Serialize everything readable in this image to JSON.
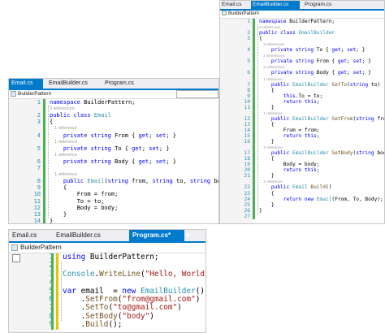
{
  "win_email": {
    "tabs": [
      "Email.cs",
      "EmailBuilder.cs",
      "Program.cs"
    ],
    "nav": "BuilderPattern",
    "lines": [
      {
        "n": "1",
        "t": [
          [
            "kw",
            "namespace "
          ],
          [
            "pl",
            "BuilderPattern;"
          ]
        ]
      },
      {
        "n": "",
        "t": [
          [
            "ref",
            "3 references"
          ]
        ]
      },
      {
        "n": "2",
        "t": [
          [
            "kw",
            "public class "
          ],
          [
            "ty",
            "Email"
          ]
        ]
      },
      {
        "n": "3",
        "t": [
          [
            "pl",
            "{"
          ]
        ]
      },
      {
        "n": "",
        "t": [
          [
            "ref",
            "    1 reference"
          ]
        ]
      },
      {
        "n": "4",
        "t": [
          [
            "kw",
            "    private string "
          ],
          [
            "pl",
            "From { "
          ],
          [
            "kw",
            "get"
          ],
          [
            "pl",
            "; "
          ],
          [
            "kw",
            "set"
          ],
          [
            "pl",
            "; }"
          ]
        ]
      },
      {
        "n": "",
        "t": [
          [
            "ref",
            "    1 reference"
          ]
        ]
      },
      {
        "n": "5",
        "t": [
          [
            "kw",
            "    private string "
          ],
          [
            "pl",
            "To { "
          ],
          [
            "kw",
            "get"
          ],
          [
            "pl",
            "; "
          ],
          [
            "kw",
            "set"
          ],
          [
            "pl",
            "; }"
          ]
        ]
      },
      {
        "n": "",
        "t": [
          [
            "ref",
            "    1 reference"
          ]
        ]
      },
      {
        "n": "6",
        "t": [
          [
            "kw",
            "    private string "
          ],
          [
            "pl",
            "Body { "
          ],
          [
            "kw",
            "get"
          ],
          [
            "pl",
            "; "
          ],
          [
            "kw",
            "set"
          ],
          [
            "pl",
            "; }"
          ]
        ]
      },
      {
        "n": "7",
        "t": [
          [
            "pl",
            ""
          ]
        ]
      },
      {
        "n": "",
        "t": [
          [
            "ref",
            "    1 reference"
          ]
        ]
      },
      {
        "n": "8",
        "t": [
          [
            "kw",
            "    public "
          ],
          [
            "ty",
            "Email"
          ],
          [
            "pl",
            "("
          ],
          [
            "kw",
            "string "
          ],
          [
            "pl",
            "from, "
          ],
          [
            "kw",
            "string "
          ],
          [
            "pl",
            "to, "
          ],
          [
            "kw",
            "string "
          ],
          [
            "pl",
            "body)"
          ]
        ]
      },
      {
        "n": "9",
        "t": [
          [
            "pl",
            "    {"
          ]
        ]
      },
      {
        "n": "10",
        "t": [
          [
            "pl",
            "        From = from;"
          ]
        ]
      },
      {
        "n": "11",
        "t": [
          [
            "pl",
            "        To = to;"
          ]
        ]
      },
      {
        "n": "12",
        "t": [
          [
            "pl",
            "        Body = body;"
          ]
        ]
      },
      {
        "n": "13",
        "t": [
          [
            "pl",
            "    }"
          ]
        ]
      },
      {
        "n": "14",
        "t": [
          [
            "pl",
            "}"
          ]
        ]
      }
    ]
  },
  "win_builder": {
    "tabs": [
      "Email.cs",
      "EmailBuilder.cs",
      "Program.cs"
    ],
    "nav": "BuilderPattern",
    "lines": [
      {
        "n": "1",
        "t": [
          [
            "kw",
            "namespace "
          ],
          [
            "pl",
            "BuilderPattern;"
          ]
        ]
      },
      {
        "n": "",
        "t": [
          [
            "ref",
            "4 references"
          ]
        ]
      },
      {
        "n": "2",
        "t": [
          [
            "kw",
            "public class "
          ],
          [
            "ty",
            "EmailBuilder"
          ]
        ]
      },
      {
        "n": "3",
        "t": [
          [
            "pl",
            "{"
          ]
        ]
      },
      {
        "n": "",
        "t": [
          [
            "ref",
            "    2 references"
          ]
        ]
      },
      {
        "n": "4",
        "t": [
          [
            "kw",
            "    private string "
          ],
          [
            "pl",
            "To { "
          ],
          [
            "kw",
            "get"
          ],
          [
            "pl",
            "; "
          ],
          [
            "kw",
            "set"
          ],
          [
            "pl",
            "; }"
          ]
        ]
      },
      {
        "n": "",
        "t": [
          [
            "ref",
            "    2 references"
          ]
        ]
      },
      {
        "n": "5",
        "t": [
          [
            "kw",
            "    private string "
          ],
          [
            "pl",
            "From { "
          ],
          [
            "kw",
            "get"
          ],
          [
            "pl",
            "; "
          ],
          [
            "kw",
            "set"
          ],
          [
            "pl",
            "; }"
          ]
        ]
      },
      {
        "n": "",
        "t": [
          [
            "ref",
            "    2 references"
          ]
        ]
      },
      {
        "n": "6",
        "t": [
          [
            "kw",
            "    private string "
          ],
          [
            "pl",
            "Body { "
          ],
          [
            "kw",
            "get"
          ],
          [
            "pl",
            "; "
          ],
          [
            "kw",
            "set"
          ],
          [
            "pl",
            "; }"
          ]
        ]
      },
      {
        "n": "",
        "t": [
          [
            "ref",
            "    1 reference"
          ]
        ]
      },
      {
        "n": "7",
        "t": [
          [
            "kw",
            "    public "
          ],
          [
            "ty",
            "EmailBuilder "
          ],
          [
            "mb",
            "SetTo"
          ],
          [
            "pl",
            "("
          ],
          [
            "kw",
            "string "
          ],
          [
            "pl",
            "to)"
          ]
        ]
      },
      {
        "n": "8",
        "t": [
          [
            "pl",
            "    {"
          ]
        ]
      },
      {
        "n": "9",
        "t": [
          [
            "kw",
            "        this"
          ],
          [
            "pl",
            ".To = to;"
          ]
        ]
      },
      {
        "n": "10",
        "t": [
          [
            "kw",
            "        return this"
          ],
          [
            "pl",
            ";"
          ]
        ]
      },
      {
        "n": "11",
        "t": [
          [
            "pl",
            "    }"
          ]
        ]
      },
      {
        "n": "",
        "t": [
          [
            "ref",
            "    1 reference"
          ]
        ]
      },
      {
        "n": "12",
        "t": [
          [
            "kw",
            "    public "
          ],
          [
            "ty",
            "EmailBuilder "
          ],
          [
            "mb",
            "SetFrom"
          ],
          [
            "pl",
            "("
          ],
          [
            "kw",
            "string "
          ],
          [
            "pl",
            "from)"
          ]
        ]
      },
      {
        "n": "13",
        "t": [
          [
            "pl",
            "    {"
          ]
        ]
      },
      {
        "n": "14",
        "t": [
          [
            "pl",
            "        From = from;"
          ]
        ]
      },
      {
        "n": "15",
        "t": [
          [
            "kw",
            "        return this"
          ],
          [
            "pl",
            ";"
          ]
        ]
      },
      {
        "n": "16",
        "t": [
          [
            "pl",
            "    }"
          ]
        ]
      },
      {
        "n": "",
        "t": [
          [
            "ref",
            "    1 reference"
          ]
        ]
      },
      {
        "n": "17",
        "t": [
          [
            "kw",
            "    public "
          ],
          [
            "ty",
            "EmailBuilder "
          ],
          [
            "mb",
            "SetBody"
          ],
          [
            "pl",
            "("
          ],
          [
            "kw",
            "string "
          ],
          [
            "pl",
            "body)"
          ]
        ]
      },
      {
        "n": "18",
        "t": [
          [
            "pl",
            "    {"
          ]
        ]
      },
      {
        "n": "19",
        "t": [
          [
            "pl",
            "        Body = body;"
          ]
        ]
      },
      {
        "n": "20",
        "t": [
          [
            "kw",
            "        return this"
          ],
          [
            "pl",
            ";"
          ]
        ]
      },
      {
        "n": "21",
        "t": [
          [
            "pl",
            "    }"
          ]
        ]
      },
      {
        "n": "",
        "t": [
          [
            "ref",
            "    1 reference"
          ]
        ]
      },
      {
        "n": "22",
        "t": [
          [
            "kw",
            "    public "
          ],
          [
            "ty",
            "Email "
          ],
          [
            "mb",
            "Build"
          ],
          [
            "pl",
            "()"
          ]
        ]
      },
      {
        "n": "23",
        "t": [
          [
            "pl",
            "    {"
          ]
        ]
      },
      {
        "n": "24",
        "t": [
          [
            "kw",
            "        return new "
          ],
          [
            "ty",
            "Email"
          ],
          [
            "pl",
            "(From, To, Body);"
          ]
        ]
      },
      {
        "n": "25",
        "t": [
          [
            "pl",
            "    }"
          ]
        ]
      },
      {
        "n": "26",
        "t": [
          [
            "pl",
            "}"
          ]
        ]
      },
      {
        "n": "27",
        "t": [
          [
            "pl",
            ""
          ]
        ]
      }
    ]
  },
  "win_program": {
    "tabs": [
      "Email.cs",
      "EmailBuilder.cs",
      "Program.cs*"
    ],
    "nav": "BuilderPattern",
    "lines": [
      {
        "n": "1",
        "t": [
          [
            "kw",
            "using "
          ],
          [
            "pl",
            "BuilderPattern;"
          ]
        ]
      },
      {
        "n": "2",
        "t": [
          [
            "pl",
            ""
          ]
        ]
      },
      {
        "n": "3",
        "t": [
          [
            "ty",
            "Console"
          ],
          [
            "pl",
            "."
          ],
          [
            "mb",
            "WriteLine"
          ],
          [
            "pl",
            "("
          ],
          [
            "str",
            "\"Hello, World!\""
          ],
          [
            "pl",
            ");"
          ]
        ]
      },
      {
        "n": "4",
        "t": [
          [
            "pl",
            ""
          ]
        ]
      },
      {
        "n": "5",
        "t": [
          [
            "kw",
            "var "
          ],
          [
            "pl",
            "email  = "
          ],
          [
            "kw",
            "new "
          ],
          [
            "ty",
            "EmailBuilder"
          ],
          [
            "pl",
            "()"
          ]
        ]
      },
      {
        "n": "6",
        "t": [
          [
            "pl",
            "    ."
          ],
          [
            "mb",
            "SetFrom"
          ],
          [
            "pl",
            "("
          ],
          [
            "str",
            "\"from@gmail.com\""
          ],
          [
            "pl",
            ")"
          ]
        ]
      },
      {
        "n": "7",
        "t": [
          [
            "pl",
            "    ."
          ],
          [
            "mb",
            "SetTo"
          ],
          [
            "pl",
            "("
          ],
          [
            "str",
            "\"to@gmail.com\""
          ],
          [
            "pl",
            ")"
          ]
        ]
      },
      {
        "n": "8",
        "t": [
          [
            "pl",
            "    ."
          ],
          [
            "mb",
            "SetBody"
          ],
          [
            "pl",
            "("
          ],
          [
            "str",
            "\"body\""
          ],
          [
            "pl",
            ")"
          ]
        ]
      },
      {
        "n": "9",
        "t": [
          [
            "pl",
            "    ."
          ],
          [
            "mb",
            "Build"
          ],
          [
            "pl",
            "();"
          ]
        ]
      }
    ]
  },
  "colors": {
    "accent": "#007acc",
    "lineNumber": "#2b91af",
    "keyword": "#0000ff",
    "type": "#2b91af",
    "string": "#a31515",
    "reference": "#999999",
    "changeBar": "#4caf50",
    "editBar": "#e8c400"
  }
}
